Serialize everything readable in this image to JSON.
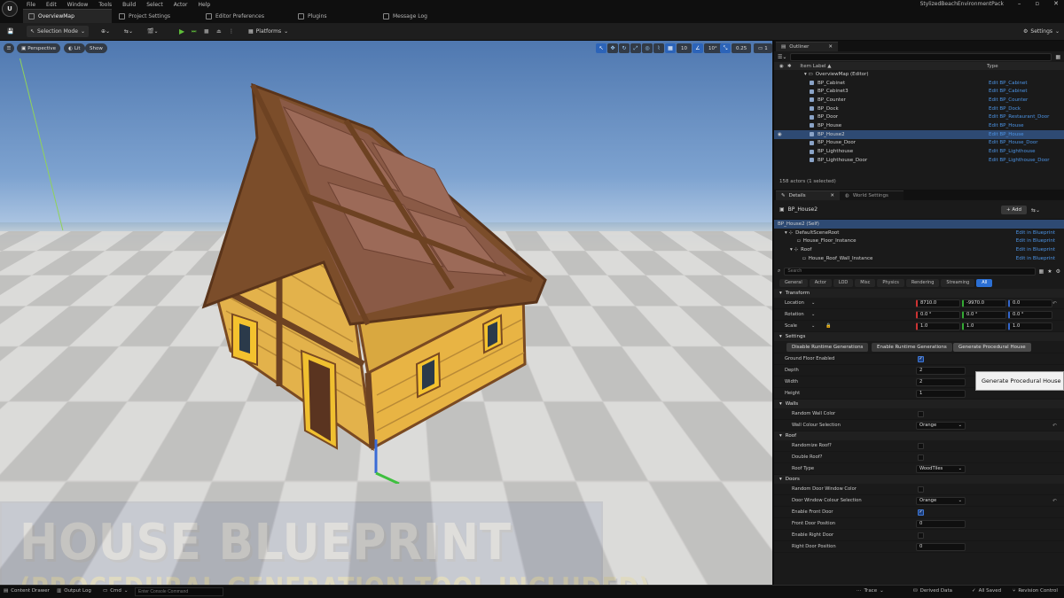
{
  "menu": {
    "items": [
      "File",
      "Edit",
      "Window",
      "Tools",
      "Build",
      "Select",
      "Actor",
      "Help"
    ],
    "project": "StylizedBeachEnvironmentPack"
  },
  "tabs": [
    "OverviewMap",
    "Project Settings",
    "Editor Preferences",
    "Plugins",
    "Message Log"
  ],
  "toolbar": {
    "selection_mode": "Selection Mode",
    "platforms": "Platforms",
    "settings": "Settings"
  },
  "viewport": {
    "perspective": "Perspective",
    "lit": "Lit",
    "show": "Show",
    "grid": "10",
    "angle": "10°",
    "scale": "0.25",
    "camera": "1"
  },
  "banner": {
    "title": "HOUSE BLUEPRINT",
    "subtitle": "(PROCEDURAL GENERATION TOOL INCLUDED)"
  },
  "outliner": {
    "title": "Outliner",
    "col_label": "Item Label ▲",
    "col_type": "Type",
    "root": "OverviewMap (Editor)",
    "rows": [
      {
        "label": "BP_Cabinet",
        "type": "Edit BP_Cabinet"
      },
      {
        "label": "BP_Cabinet3",
        "type": "Edit BP_Cabinet"
      },
      {
        "label": "BP_Counter",
        "type": "Edit BP_Counter"
      },
      {
        "label": "BP_Dock",
        "type": "Edit BP_Dock"
      },
      {
        "label": "BP_Door",
        "type": "Edit BP_Restaurant_Door"
      },
      {
        "label": "BP_House",
        "type": "Edit BP_House"
      },
      {
        "label": "BP_House2",
        "type": "Edit BP_House"
      },
      {
        "label": "BP_House_Door",
        "type": "Edit BP_House_Door"
      },
      {
        "label": "BP_Lighthouse",
        "type": "Edit BP_Lighthouse"
      },
      {
        "label": "BP_Lighthouse_Door",
        "type": "Edit BP_Lighthouse_Door"
      }
    ],
    "footer": "158 actors (1 selected)"
  },
  "details": {
    "tab": "Details",
    "tab2": "World Settings",
    "actor": "BP_House2",
    "add": "+ Add",
    "components": [
      {
        "label": "BP_House2 (Self)",
        "link": ""
      },
      {
        "label": "DefaultSceneRoot",
        "link": "Edit in Blueprint"
      },
      {
        "label": "House_Floor_Instance",
        "link": "Edit in Blueprint"
      },
      {
        "label": "Roof",
        "link": "Edit in Blueprint"
      },
      {
        "label": "House_Roof_Wall_Instance",
        "link": "Edit in Blueprint"
      }
    ],
    "search_placeholder": "Search",
    "categories": [
      "General",
      "Actor",
      "LOD",
      "Misc",
      "Physics",
      "Rendering",
      "Streaming",
      "All"
    ],
    "transform": {
      "title": "Transform",
      "location": {
        "label": "Location",
        "x": "8710.0",
        "y": "-9970.0",
        "z": "0.0"
      },
      "rotation": {
        "label": "Rotation",
        "x": "0.0 °",
        "y": "0.0 °",
        "z": "0.0 °"
      },
      "scale": {
        "label": "Scale",
        "x": "1.0",
        "y": "1.0",
        "z": "1.0"
      }
    },
    "settings": {
      "title": "Settings",
      "btn_disable": "Disable Runtime Generations",
      "btn_enable": "Enable Runtime Generations",
      "btn_generate": "Generate Procedural House",
      "ground_floor": "Ground Floor Enabled",
      "depth": {
        "label": "Depth",
        "value": "2"
      },
      "width": {
        "label": "Width",
        "value": "2"
      },
      "height": {
        "label": "Height",
        "value": "1"
      }
    },
    "walls": {
      "title": "Walls",
      "random_color": "Random Wall Color",
      "colour_sel": "Wall Colour Selection",
      "colour_value": "Orange"
    },
    "roof": {
      "title": "Roof",
      "randomize": "Randomize Roof?",
      "double": "Double Roof?",
      "type": "Roof Type",
      "type_value": "WoodTiles"
    },
    "doors": {
      "title": "Doors",
      "random_color": "Random Door Window Color",
      "colour_sel": "Door Window Colour Selection",
      "colour_value": "Orange",
      "front": "Enable Front Door",
      "front_pos": "Front Door Position",
      "front_pos_value": "0",
      "right": "Enable Right Door",
      "right_pos": "Right Door Position",
      "right_pos_value": "0"
    }
  },
  "tooltip": "Generate Procedural House",
  "status": {
    "content_drawer": "Content Drawer",
    "output_log": "Output Log",
    "cmd": "Cmd",
    "console_placeholder": "Enter Console Command",
    "trace": "Trace",
    "derived": "Derived Data",
    "saved": "All Saved",
    "revision": "Revision Control"
  }
}
